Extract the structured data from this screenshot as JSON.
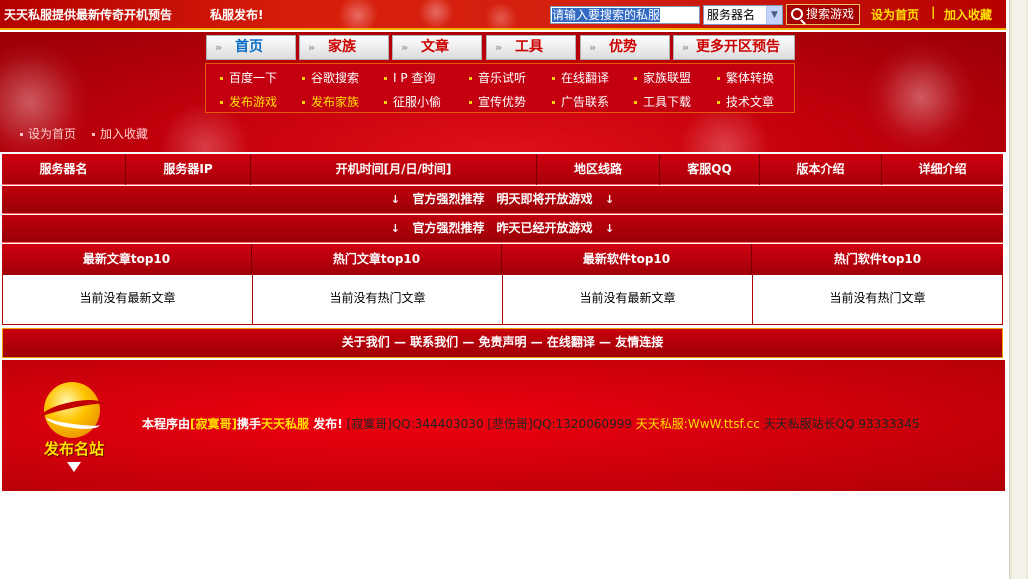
{
  "topbar": {
    "site_title": "天天私服提供最新传奇开机预告",
    "publish_text": "私服发布!",
    "search_placeholder": "请输入要搜索的私服",
    "search_select": "服务器名",
    "search_button": "搜索游戏",
    "home_link": "设为首页",
    "separator": "|",
    "favorite_link": "加入收藏"
  },
  "nav": {
    "tabs": [
      "首页",
      "家族",
      "文章",
      "工具",
      "优势"
    ],
    "more": "更多开区预告"
  },
  "subnav": {
    "row1": [
      "百度一下",
      "谷歌搜索",
      "I P 查询",
      "音乐试听",
      "在线翻译",
      "家族联盟",
      "繁体转换"
    ],
    "row2": [
      "发布游戏",
      "发布家族",
      "征服小偷",
      "宣传优势",
      "广告联系",
      "工具下载",
      "技术文章"
    ]
  },
  "header_links": {
    "home": "设为首页",
    "favorite": "加入收藏"
  },
  "table": {
    "columns": [
      "服务器名",
      "服务器IP",
      "开机时间[月/日/时间]",
      "地区线路",
      "客服QQ",
      "版本介绍",
      "详细介绍"
    ],
    "banner_tomorrow": "官方强烈推荐　明天即将开放游戏",
    "banner_yesterday": "官方强烈推荐　昨天已经开放游戏",
    "arrow": "↓"
  },
  "top10": {
    "headers": [
      "最新文章top10",
      "热门文章top10",
      "最新软件top10",
      "热门软件top10"
    ],
    "bodies": [
      "当前没有最新文章",
      "当前没有热门文章",
      "当前没有最新文章",
      "当前没有热门文章"
    ]
  },
  "footer_nav": "关于我们 — 联系我们 — 免责声明 — 在线翻译 — 友情连接",
  "footer": {
    "logo_text": "发布名站",
    "info_program": "本程序由",
    "info_author": "[寂寞哥]",
    "info_with": "携手",
    "info_brand": "天天私服",
    "info_publish": " 发布!",
    "info_contacts": "  [寂寞哥]QQ:344403030 [悲伤哥]QQ:1320060999 ",
    "info_site": "天天私服:WwW.ttsf.cc",
    "info_owner": " 天天私服站长QQ 93333345"
  },
  "colors": {
    "primary_red": "#c40010",
    "accent_yellow": "#ffe000",
    "link_blue": "#0a6ec8"
  }
}
